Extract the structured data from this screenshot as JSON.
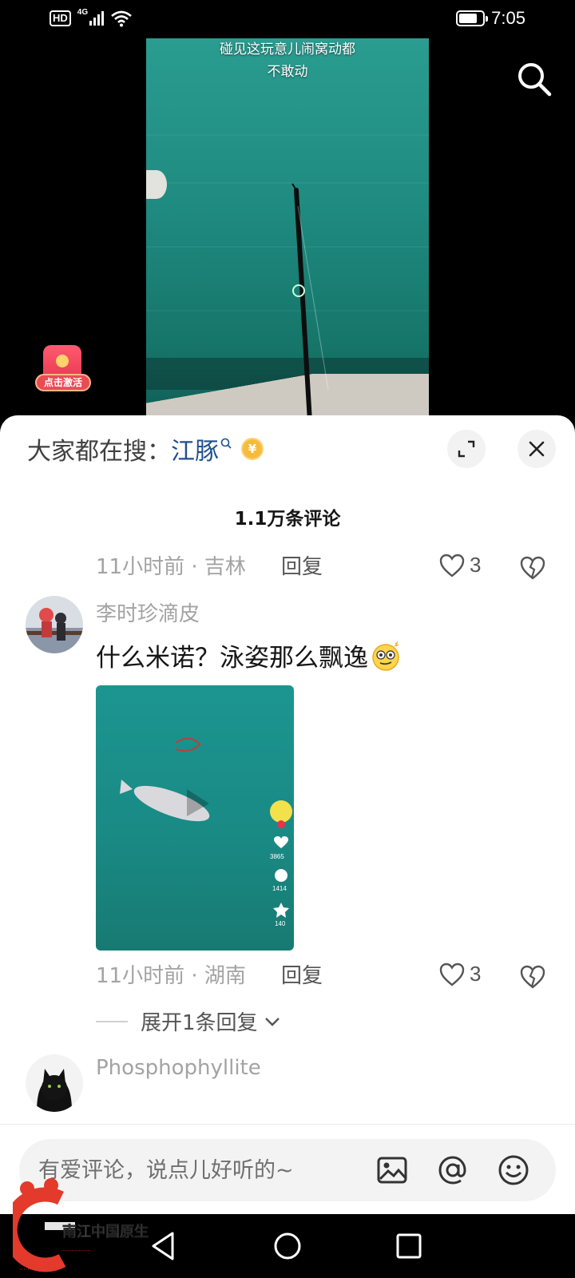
{
  "status_bar": {
    "hd": "HD",
    "network": "4G",
    "time": "7:05",
    "battery_level": 0.8
  },
  "video": {
    "subtitle_line1": "碰见这玩意儿闹窝动都",
    "subtitle_line2": "不敢动",
    "search_icon": "search-icon",
    "redpacket_label": "点击激活"
  },
  "sheet": {
    "trending_label": "大家都在搜：",
    "trending_term": "江豚",
    "coin_symbol": "¥",
    "comment_count": "1.1万条评论",
    "expand_icon": "expand-icon",
    "close_icon": "close-icon"
  },
  "comments": [
    {
      "time_location": "11小时前 · 吉林",
      "reply_label": "回复",
      "likes": "3"
    },
    {
      "username": "李时珍滴皮",
      "text": "什么米诺？泳姿那么飘逸",
      "time_location": "11小时前 · 湖南",
      "reply_label": "回复",
      "likes": "3",
      "expand_replies": "展开1条回复",
      "thumb_stats": {
        "likes": "3865",
        "comments": "1414",
        "favorites": "140"
      }
    },
    {
      "username": "Phosphophyllite"
    }
  ],
  "input_bar": {
    "placeholder": "有爱评论，说点儿好听的~",
    "icons": [
      "image-icon",
      "at-icon",
      "emoji-icon"
    ]
  },
  "watermark": {
    "text": "南江中国原生"
  },
  "colors": {
    "accent_link": "#1f4f8c",
    "muted_text": "#a3a3a3",
    "video_water": "#1f8a80"
  }
}
